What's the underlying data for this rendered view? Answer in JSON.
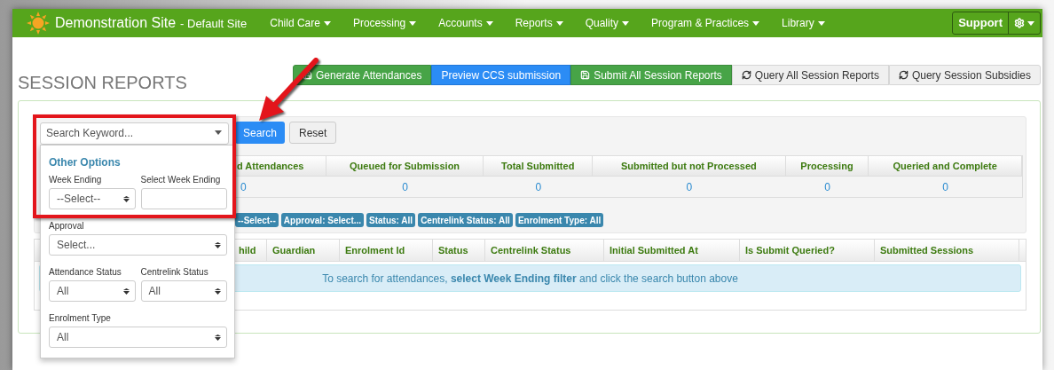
{
  "navbar": {
    "brand": "Demonstration Site",
    "site": "- Default Site",
    "menu": [
      {
        "label": "Child Care"
      },
      {
        "label": "Processing"
      },
      {
        "label": "Accounts"
      },
      {
        "label": "Reports"
      },
      {
        "label": "Quality"
      },
      {
        "label": "Program & Practices"
      },
      {
        "label": "Library"
      }
    ],
    "support": "Support"
  },
  "page_title": "SESSION REPORTS",
  "actions": [
    {
      "label": "Generate Attendances",
      "kind": "save"
    },
    {
      "label": "Preview CCS submission",
      "kind": "preview"
    },
    {
      "label": "Submit All Session Reports",
      "kind": "save"
    },
    {
      "label": "Query All Session Reports",
      "kind": "refresh"
    },
    {
      "label": "Query Session Subsidies",
      "kind": "refresh"
    }
  ],
  "search": {
    "placeholder": "Search Keyword...",
    "search_button": "Search",
    "reset_button": "Reset"
  },
  "summary": {
    "columns": [
      "d Attendances",
      "Queued for Submission",
      "Total Submitted",
      "Submitted but not Processed",
      "Processing",
      "Queried and Complete"
    ],
    "values": [
      "0",
      "0",
      "0",
      "0",
      "0",
      "0"
    ]
  },
  "filter_tags": [
    "--Select--",
    "Approval: Select...",
    "Status: All",
    "Centrelink Status: All",
    "Enrolment Type: All"
  ],
  "results": {
    "columns": [
      "hild",
      "Guardian",
      "Enrolment Id",
      "Status",
      "Centrelink Status",
      "Initial Submitted At",
      "Is Submit Queried?",
      "Submitted Sessions"
    ],
    "message": "To search for attendances, **select Week Ending filter** and click the search button above"
  },
  "options_panel": {
    "title": "Other Options",
    "rows": [
      [
        {
          "label": "Week Ending",
          "kind": "select",
          "value": "--Select--"
        },
        {
          "label": "Select Week Ending",
          "kind": "input"
        }
      ],
      [
        {
          "label": "Approval",
          "kind": "select",
          "value": "Select..."
        }
      ],
      [
        {
          "label": "Attendance Status",
          "kind": "select",
          "value": "All"
        },
        {
          "label": "Centrelink Status",
          "kind": "select",
          "value": "All"
        }
      ],
      [
        {
          "label": "Enrolment Type",
          "kind": "select",
          "value": "All"
        }
      ]
    ]
  }
}
